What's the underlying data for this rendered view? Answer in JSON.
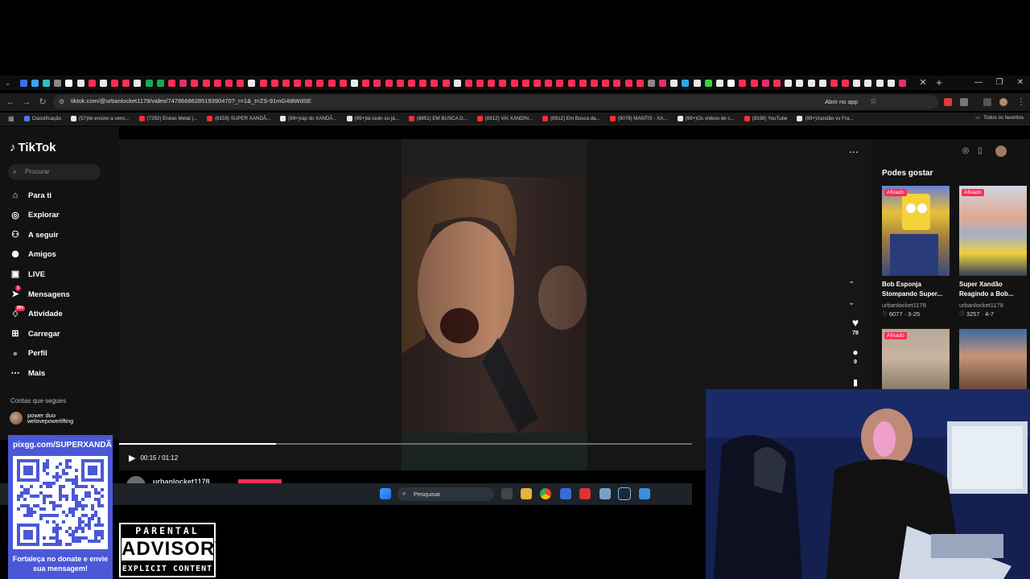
{
  "browser": {
    "tab_favicons": [
      "#3d6ef0",
      "#3fa0ff",
      "#2fc0c0",
      "#888888",
      "#ffffff",
      "#e8e8e8",
      "#ff2d55",
      "#e8e8e8",
      "#ff2d55",
      "#ff2d55",
      "#e8e8e8",
      "#1fa855",
      "#1fa855",
      "#ff2d55",
      "#e1306c",
      "#ff2d55",
      "#ff2d55",
      "#ff2d55",
      "#ff2d55",
      "#ff2d55",
      "#e8e8e8",
      "#ff2d55",
      "#ff2d55",
      "#ff2d55",
      "#ff2d55",
      "#ff2d55",
      "#ff2d55",
      "#ff2d55",
      "#ff2d55",
      "#e8e8e8",
      "#ff2d55",
      "#ff2d55",
      "#ff2d55",
      "#ff2d55",
      "#ff2d55",
      "#ff2d55",
      "#ff2d55",
      "#ff2d55",
      "#e8e8e8",
      "#ff2d55",
      "#ff2d55",
      "#ff2d55",
      "#ff2d55",
      "#ff2d55",
      "#ff2d55",
      "#ff2d55",
      "#ff2d55",
      "#ff2d55",
      "#ff2d55",
      "#ff2d55",
      "#ff2d55",
      "#ff2d55",
      "#ff2d55",
      "#ff2d55",
      "#ff2d55",
      "#888888",
      "#e1306c",
      "#e8e8e8",
      "#2ea6e8",
      "#e8e8e8",
      "#3fd23f",
      "#e8e8e8",
      "#ffffff",
      "#ff2d55",
      "#ff2d55",
      "#e1306c",
      "#ff2d55",
      "#e8e8e8",
      "#e8e8e8",
      "#e8e8e8",
      "#e8e8e8",
      "#ff2d55",
      "#ff2d55",
      "#e8e8e8",
      "#e8e8e8",
      "#e8e8e8",
      "#e8e8e8",
      "#e1306c"
    ],
    "url": "tiktok.com/@urbanlocket1178/video/7478668628519390470?_r=1&_t=ZS-91mG4t8WdSE",
    "open_in_app": "Abrir no app",
    "bookmarks": [
      {
        "label": "Classificação",
        "color": "#4a7bf0"
      },
      {
        "label": "(57)Ile ensino a venc...",
        "color": "#e8e8e8"
      },
      {
        "label": "(7292) Enéas Metal |...",
        "color": "#ff2d2d"
      },
      {
        "label": "(8159) SUPER XANDÃ...",
        "color": "#ff2d2d"
      },
      {
        "label": "(99+)rap do XANDÃ...",
        "color": "#e8e8e8"
      },
      {
        "label": "(99+)tá cedo ou já...",
        "color": "#e8e8e8"
      },
      {
        "label": "(8851) EM BUSCA D...",
        "color": "#ff2d2d"
      },
      {
        "label": "(8912) VAI XANDIN...",
        "color": "#ff2d2d"
      },
      {
        "label": "(8912) Em Busca da...",
        "color": "#ff2d2d"
      },
      {
        "label": "(9078) MANTIS - XA...",
        "color": "#ff2d2d"
      },
      {
        "label": "(99+)Os vídeos de c...",
        "color": "#e8e8e8"
      },
      {
        "label": "(9338) YouTube",
        "color": "#ff2d2d"
      },
      {
        "label": "(99+)Xandão vs Fra...",
        "color": "#e8e8e8"
      }
    ],
    "all_favorites": "Todos os favoritos"
  },
  "tiktok": {
    "logo": "TikTok",
    "search_placeholder": "Procurar",
    "nav": [
      {
        "label": "Para ti",
        "icon": "home-icon"
      },
      {
        "label": "Explorar",
        "icon": "compass-icon"
      },
      {
        "label": "A seguir",
        "icon": "user-plus-icon"
      },
      {
        "label": "Amigos",
        "icon": "friends-icon"
      },
      {
        "label": "LIVE",
        "icon": "live-icon"
      },
      {
        "label": "Mensagens",
        "icon": "send-icon",
        "badge": "1"
      },
      {
        "label": "Atividade",
        "icon": "bell-icon",
        "badge": "99+"
      },
      {
        "label": "Carregar",
        "icon": "upload-icon"
      },
      {
        "label": "Perfil",
        "icon": "avatar-icon"
      },
      {
        "label": "Mais",
        "icon": "more-icon"
      }
    ],
    "following_title": "Contas que segues",
    "following": [
      {
        "name": "power duo",
        "handle": "welovepowerlifting"
      }
    ],
    "video": {
      "time": "00:15 / 01:12",
      "progress": 0.274,
      "likes": "78",
      "comments": "9",
      "author": "urbanlocket1178"
    },
    "recommendations_title": "Podes gostar",
    "recommendations": [
      {
        "title": "Bob Esponja Stompando Super...",
        "user": "urbanlocket1178",
        "likes": "6077",
        "date": "3-25",
        "pinned": "Afixado"
      },
      {
        "title": "Super Xandão Reagindo a Bob...",
        "user": "urbanlocket1178",
        "likes": "3257",
        "date": "4-7",
        "pinned": "Afixado"
      },
      {
        "title": "",
        "user": "",
        "likes": "",
        "date": "",
        "pinned": "Afixado"
      },
      {
        "title": "",
        "user": "",
        "likes": "",
        "date": "",
        "pinned": ""
      }
    ]
  },
  "taskbar": {
    "search_placeholder": "Pesquisar"
  },
  "overlay": {
    "donate_url": "pixgg.com/SUPERXANDÃ",
    "donate_caption": "Fortaleça no donate e envie sua mensagem!",
    "advisory_line1": "PARENTAL",
    "advisory_line2": "ADVISORY",
    "advisory_line3": "EXPLICIT CONTENT"
  }
}
